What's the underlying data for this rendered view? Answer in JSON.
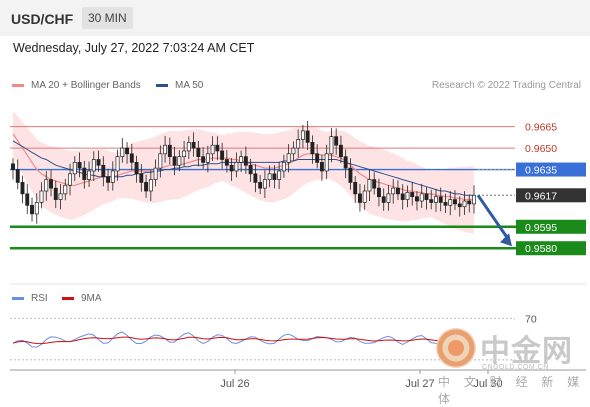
{
  "header": {
    "symbol": "USD/CHF",
    "timeframe": "30 MIN"
  },
  "date_line": "Wednesday, July 27, 2022 7:03:24 AM CET",
  "legend": {
    "ma20_label": "MA 20 + Bollinger Bands",
    "ma50_label": "MA 50",
    "research": "Research © 2022 Trading Central",
    "rsi_label": "RSI",
    "ma9_label": "9MA"
  },
  "colors": {
    "ma20": "#f08a8a",
    "ma50": "#2e4f8f",
    "support": "#1a8a1a",
    "resistance": "#e07a7a",
    "pivot": "#3a6fd8",
    "rsi": "#6b8fe0",
    "ma9": "#cc1111",
    "bb_fill": "#fde3e3"
  },
  "watermark": {
    "title": "中金网",
    "url": "CNGOLD.COM.CN",
    "sub": "中 文 财 经 新 媒 体"
  },
  "chart_data": {
    "type": "candlestick",
    "ylim": [
      0.9555,
      0.9685
    ],
    "levels": [
      {
        "label": "0.9665",
        "value": 0.9665,
        "kind": "resistance"
      },
      {
        "label": "0.9650",
        "value": 0.965,
        "kind": "resistance"
      },
      {
        "label": "0.9635",
        "value": 0.9635,
        "kind": "pivot"
      },
      {
        "label": "0.9617",
        "value": 0.9617,
        "kind": "last"
      },
      {
        "label": "0.9595",
        "value": 0.9595,
        "kind": "support"
      },
      {
        "label": "0.9580",
        "value": 0.958,
        "kind": "support"
      }
    ],
    "x_tick_labels": [
      "Jul 26",
      "Jul 27",
      "Jul 30"
    ],
    "closes": [
      0.9635,
      0.9626,
      0.9618,
      0.961,
      0.9604,
      0.9612,
      0.962,
      0.9628,
      0.9622,
      0.9614,
      0.9618,
      0.9624,
      0.9632,
      0.964,
      0.9636,
      0.9628,
      0.9634,
      0.9642,
      0.9638,
      0.963,
      0.9626,
      0.9634,
      0.9644,
      0.965,
      0.9646,
      0.964,
      0.9632,
      0.9626,
      0.962,
      0.9628,
      0.9636,
      0.9646,
      0.9652,
      0.9644,
      0.9638,
      0.9644,
      0.9648,
      0.9654,
      0.965,
      0.9644,
      0.964,
      0.9646,
      0.9652,
      0.9648,
      0.9642,
      0.9638,
      0.9634,
      0.964,
      0.9644,
      0.9638,
      0.9632,
      0.9626,
      0.9622,
      0.9628,
      0.9632,
      0.9628,
      0.9634,
      0.964,
      0.9646,
      0.965,
      0.9656,
      0.9662,
      0.9654,
      0.9646,
      0.964,
      0.9634,
      0.9646,
      0.9658,
      0.9652,
      0.9644,
      0.9636,
      0.9626,
      0.9618,
      0.9612,
      0.962,
      0.9628,
      0.9622,
      0.9616,
      0.9612,
      0.9618,
      0.9622,
      0.9618,
      0.9614,
      0.9619,
      0.9616,
      0.9613,
      0.9618,
      0.9614,
      0.9612,
      0.9616,
      0.9612,
      0.961,
      0.9614,
      0.9611,
      0.9609,
      0.9613,
      0.9611,
      0.9617
    ],
    "ma20": [
      0.966,
      0.9655,
      0.965,
      0.9645,
      0.964,
      0.9635,
      0.9632,
      0.963,
      0.9628,
      0.9627,
      0.9626,
      0.9625,
      0.9624,
      0.9624,
      0.9625,
      0.9626,
      0.9627,
      0.9628,
      0.9629,
      0.963,
      0.963,
      0.963,
      0.9631,
      0.9632,
      0.9633,
      0.9634,
      0.9634,
      0.9634,
      0.9634,
      0.9634,
      0.9635,
      0.9636,
      0.9637,
      0.9638,
      0.9638,
      0.9638,
      0.9639,
      0.964,
      0.9641,
      0.9642,
      0.9642,
      0.9642,
      0.9643,
      0.9643,
      0.9643,
      0.9643,
      0.9642,
      0.9642,
      0.9641,
      0.964,
      0.9639,
      0.9638,
      0.9637,
      0.9636,
      0.9636,
      0.9636,
      0.9637,
      0.9638,
      0.9639,
      0.9641,
      0.9643,
      0.9645,
      0.9646,
      0.9646,
      0.9646,
      0.9645,
      0.9645,
      0.9645,
      0.9644,
      0.9643,
      0.9641,
      0.9638,
      0.9635,
      0.9632,
      0.963,
      0.9628,
      0.9627,
      0.9626,
      0.9625,
      0.9624,
      0.9623,
      0.9622,
      0.9621,
      0.962,
      0.962,
      0.9619,
      0.9619,
      0.9618,
      0.9618,
      0.9617,
      0.9617,
      0.9616,
      0.9616,
      0.9615,
      0.9615,
      0.9614,
      0.9614,
      0.9614
    ],
    "ma50": [
      0.9655,
      0.9653,
      0.9651,
      0.9649,
      0.9647,
      0.9645,
      0.9643,
      0.9642,
      0.964,
      0.9638,
      0.9637,
      0.9636,
      0.9635,
      0.9634,
      0.9633,
      0.9632,
      0.9631,
      0.9631,
      0.963,
      0.963,
      0.963,
      0.963,
      0.963,
      0.963,
      0.9631,
      0.9631,
      0.9632,
      0.9632,
      0.9633,
      0.9633,
      0.9634,
      0.9634,
      0.9635,
      0.9635,
      0.9636,
      0.9636,
      0.9637,
      0.9637,
      0.9638,
      0.9638,
      0.9638,
      0.9639,
      0.9639,
      0.9639,
      0.964,
      0.964,
      0.964,
      0.964,
      0.964,
      0.964,
      0.964,
      0.964,
      0.964,
      0.964,
      0.964,
      0.964,
      0.964,
      0.9641,
      0.9641,
      0.9641,
      0.9642,
      0.9642,
      0.9642,
      0.9642,
      0.9642,
      0.9642,
      0.9642,
      0.9642,
      0.9642,
      0.9641,
      0.964,
      0.9639,
      0.9638,
      0.9637,
      0.9636,
      0.9635,
      0.9634,
      0.9633,
      0.9632,
      0.9631,
      0.963,
      0.9629,
      0.9628,
      0.9627,
      0.9626,
      0.9625,
      0.9624,
      0.9623,
      0.9622,
      0.9621,
      0.962,
      0.962,
      0.9619,
      0.9618,
      0.9618,
      0.9617,
      0.9617,
      0.9617
    ],
    "rsi": {
      "level_label": "70",
      "range": [
        25,
        80
      ],
      "overbought": 70,
      "oversold": 30
    }
  }
}
